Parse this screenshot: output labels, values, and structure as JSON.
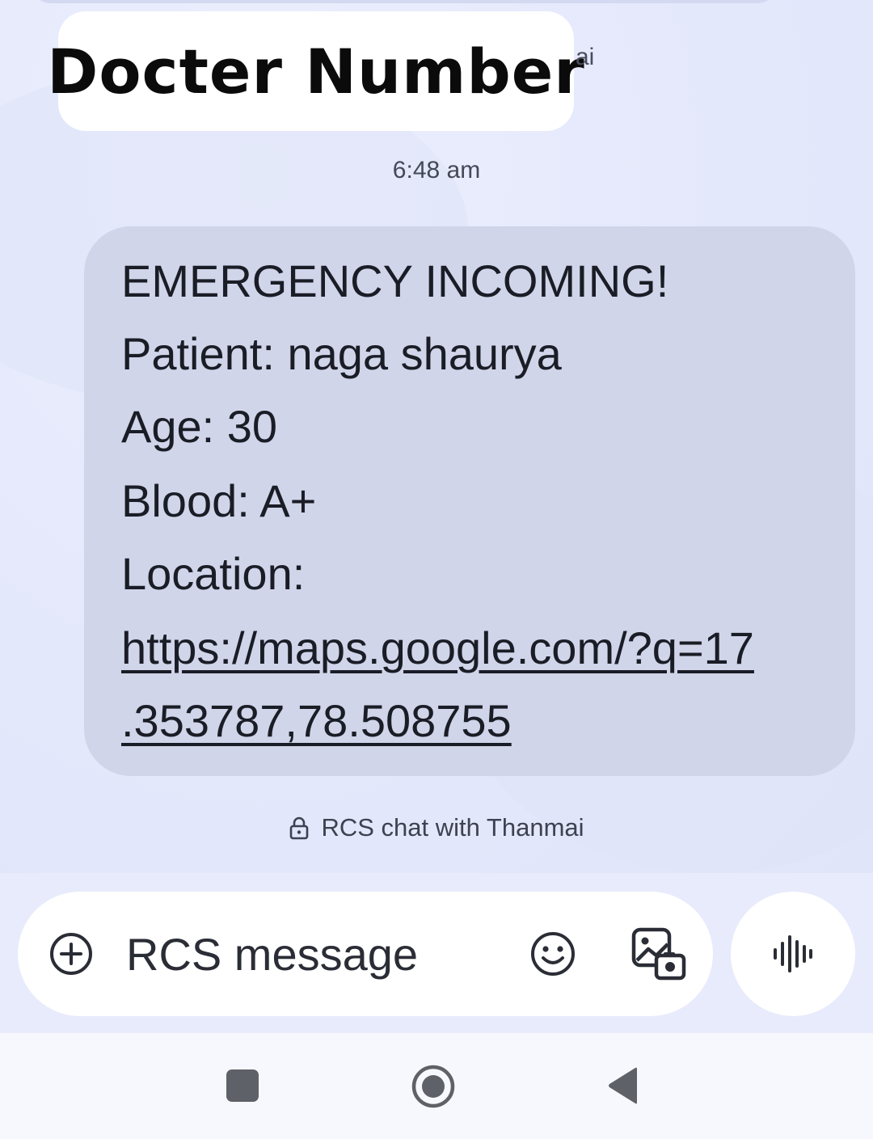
{
  "conversation": {
    "sticker_text": "Docter Number",
    "partial_label": "ai",
    "timestamp": "6:48 am"
  },
  "message": {
    "line1": "EMERGENCY INCOMING!",
    "line2": "Patient: naga shaurya",
    "line3": "Age: 30",
    "line4": "Blood: A+",
    "line5": "Location:",
    "link_line1": "https://maps.google.com/?q=17",
    "link_line2": ".353787,78.508755"
  },
  "rcs_info": {
    "text": "RCS chat with Thanmai",
    "icon": "lock-icon"
  },
  "composer": {
    "placeholder": "RCS message",
    "add_icon": "plus-circle-icon",
    "emoji_icon": "emoji-icon",
    "gallery_icon": "gallery-icon",
    "voice_icon": "voice-waveform-icon"
  },
  "navigation": {
    "recents_icon": "square-icon",
    "home_icon": "circle-icon",
    "back_icon": "back-triangle-icon"
  },
  "colors": {
    "chat_background": "#e6e9fb",
    "bubble": "#d0d5ea",
    "text": "#1b1d26",
    "composer": "#ffffff",
    "nav_icons": "#5f6168"
  }
}
